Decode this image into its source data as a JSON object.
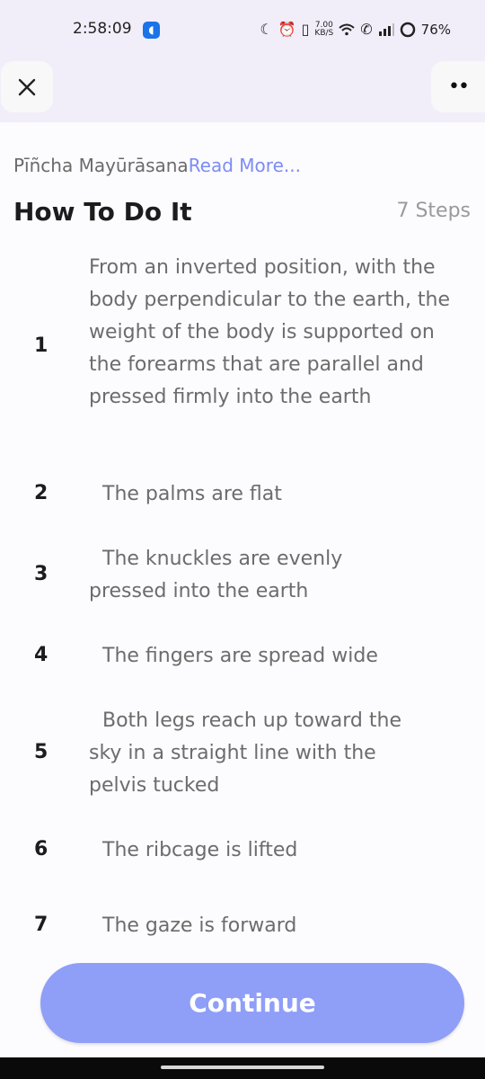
{
  "status_bar": {
    "time": "2:58:09",
    "net_speed_value": "7.00",
    "net_speed_unit": "KB/S",
    "battery": "76%",
    "icons": [
      "moon-icon",
      "alarm-icon",
      "vibrate-icon",
      "wifi-icon",
      "wifi-call-icon",
      "signal-icon",
      "battery-ring-icon"
    ]
  },
  "header": {
    "close_icon": "close-icon",
    "more_icon": "more-icon"
  },
  "pose": {
    "name": "Pīñcha Mayūrāsana",
    "read_more": "Read More..."
  },
  "section": {
    "title": "How To Do It",
    "count_label": "7 Steps"
  },
  "steps": [
    {
      "num": "1",
      "text": "From an inverted position, with the body perpendicular to the earth, the weight of the body is supported on the forearms that are parallel and pressed firmly into the earth"
    },
    {
      "num": "2",
      "text": "The palms are flat"
    },
    {
      "num": "3",
      "text": "The knuckles are evenly pressed into the earth"
    },
    {
      "num": "4",
      "text": "The fingers are spread wide"
    },
    {
      "num": "5",
      "text": "Both legs reach up toward the sky in a straight line with the pelvis tucked"
    },
    {
      "num": "6",
      "text": "The ribcage is lifted"
    },
    {
      "num": "7",
      "text": "The gaze is forward"
    }
  ],
  "footer": {
    "continue_label": "Continue"
  },
  "colors": {
    "accent": "#8f9ef7",
    "link": "#7b8df5",
    "header_bg": "#f1eef9"
  }
}
